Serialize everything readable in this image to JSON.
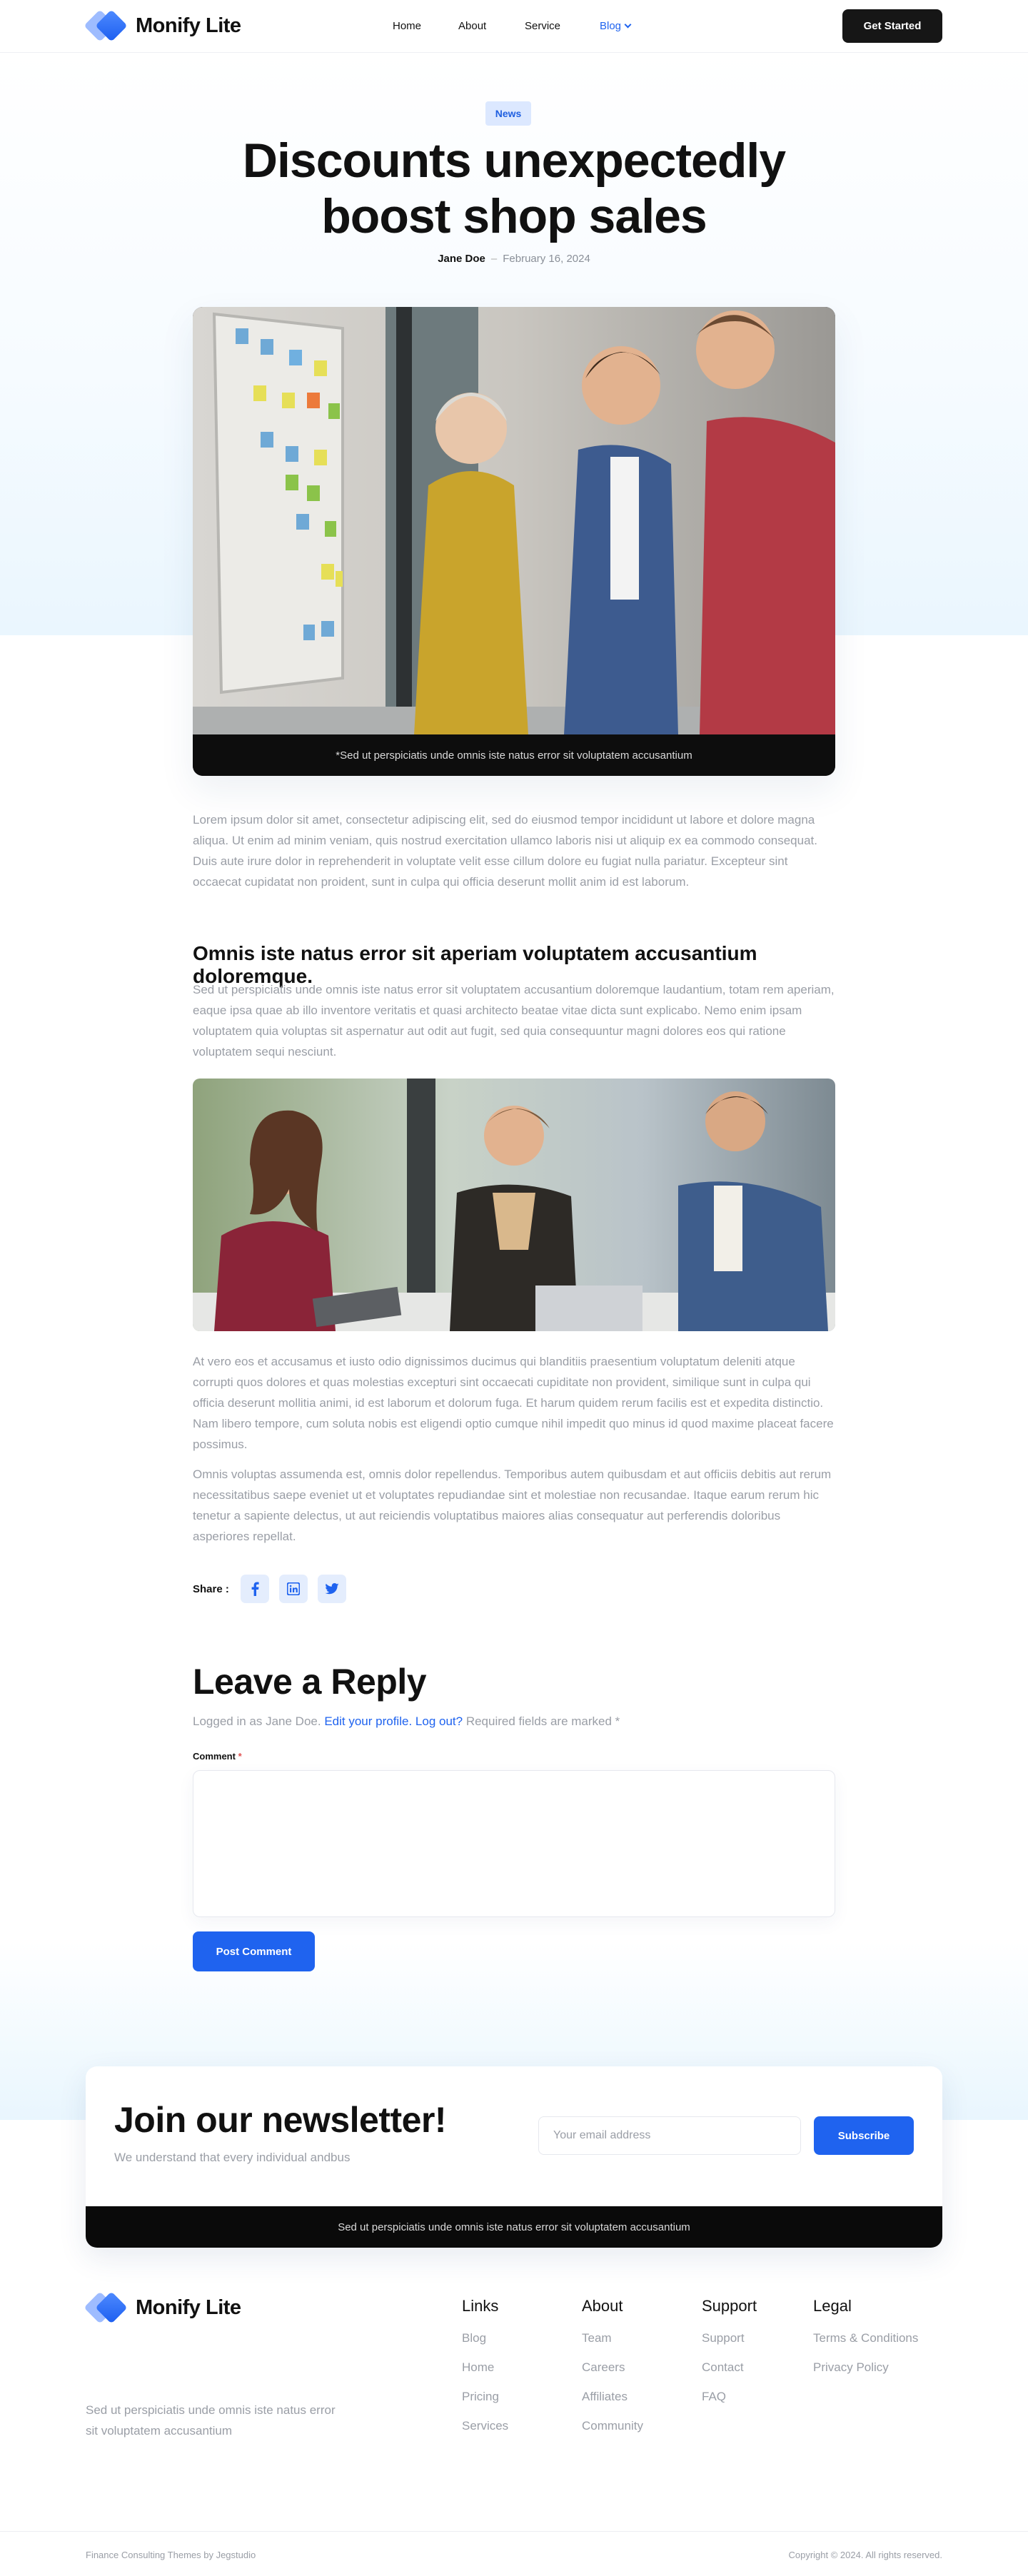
{
  "brand": {
    "name": "Monify Lite"
  },
  "nav": {
    "items": [
      {
        "label": "Home"
      },
      {
        "label": "About"
      },
      {
        "label": "Service"
      },
      {
        "label": "Blog"
      }
    ],
    "cta": "Get Started"
  },
  "article": {
    "category": "News",
    "title": "Discounts unexpectedly boost shop sales",
    "author": "Jane Doe",
    "separator": "–",
    "date": "February 16, 2024",
    "hero_caption": "*Sed ut perspiciatis unde omnis iste natus error sit voluptatem accusantium",
    "intro": "Lorem ipsum dolor sit amet, consectetur adipiscing elit, sed do eiusmod tempor incididunt ut labore et dolore magna aliqua. Ut enim ad minim veniam, quis nostrud exercitation ullamco laboris nisi ut aliquip ex ea commodo consequat. Duis aute irure dolor in reprehenderit in voluptate velit esse cillum dolore eu fugiat nulla pariatur. Excepteur sint occaecat cupidatat non proident, sunt in culpa qui officia deserunt mollit anim id est laborum.",
    "subheading": "Omnis iste natus error sit aperiam voluptatem accusantium doloremque.",
    "para2": "Sed ut perspiciatis unde omnis iste natus error sit voluptatem accusantium doloremque laudantium, totam rem aperiam, eaque ipsa quae ab illo inventore veritatis et quasi architecto beatae vitae dicta sunt explicabo. Nemo enim ipsam voluptatem quia voluptas sit aspernatur aut odit aut fugit, sed quia consequuntur magni dolores eos qui ratione voluptatem sequi nesciunt.",
    "para3": "At vero eos et accusamus et iusto odio dignissimos ducimus qui blanditiis praesentium voluptatum deleniti atque corrupti quos dolores et quas molestias excepturi sint occaecati cupiditate non provident, similique sunt in culpa qui officia deserunt mollitia animi, id est laborum et dolorum fuga. Et harum quidem rerum facilis est et expedita distinctio. Nam libero tempore, cum soluta nobis est eligendi optio cumque nihil impedit quo minus id quod maxime placeat facere possimus.",
    "para4": "Omnis voluptas assumenda est, omnis dolor repellendus. Temporibus autem quibusdam et aut officiis debitis aut rerum necessitatibus saepe eveniet ut et voluptates repudiandae sint et molestiae non recusandae. Itaque earum rerum hic tenetur a sapiente delectus, ut aut reiciendis voluptatibus maiores alias consequatur aut perferendis doloribus asperiores repellat.",
    "share_label": "Share :",
    "share_icons": [
      "facebook-icon",
      "linkedin-icon",
      "twitter-icon"
    ]
  },
  "reply": {
    "title": "Leave a Reply",
    "logged_in_prefix": "Logged in as Jane Doe.",
    "edit_profile": "Edit your profile.",
    "logout": "Log out?",
    "required_note": "Required fields are marked *",
    "comment_label": "Comment",
    "required_mark": "*",
    "comment_value": "",
    "submit": "Post Comment"
  },
  "newsletter": {
    "title": "Join our newsletter!",
    "subtitle": "We understand that every individual andbus",
    "email_placeholder": "Your email address",
    "subscribe": "Subscribe",
    "bar_text": "Sed ut perspiciatis unde omnis iste natus error sit voluptatem accusantium"
  },
  "footer": {
    "description": "Sed ut perspiciatis unde omnis iste natus error sit voluptatem accusantium",
    "columns": [
      {
        "title": "Links",
        "items": [
          "Blog",
          "Home",
          "Pricing",
          "Services"
        ]
      },
      {
        "title": "About",
        "items": [
          "Team",
          "Careers",
          "Affiliates",
          "Community"
        ]
      },
      {
        "title": "Support",
        "items": [
          "Support",
          "Contact",
          "FAQ"
        ]
      },
      {
        "title": "Legal",
        "items": [
          "Terms & Conditions",
          "Privacy Policy"
        ]
      }
    ],
    "credit": "Finance Consulting Themes by Jegstudio",
    "copyright": "Copyright © 2024. All rights reserved."
  },
  "colors": {
    "accent": "#1f63ef",
    "dark": "#161616",
    "muted_text": "#9a9ea6",
    "badge_bg": "#dce8ff"
  }
}
